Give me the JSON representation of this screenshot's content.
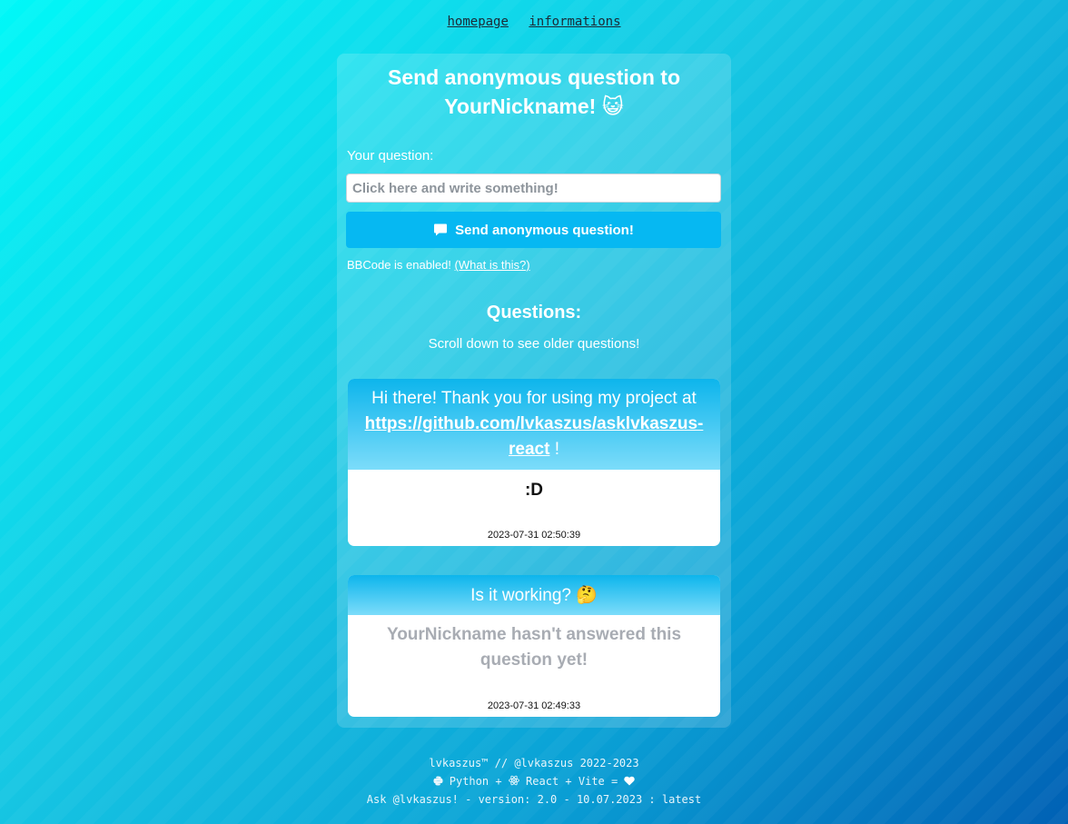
{
  "nav": {
    "links": [
      "homepage",
      "informations"
    ]
  },
  "form": {
    "title_line1": "Send anonymous question to",
    "title_line2": "YourNickname!",
    "title_emoji": "😺",
    "question_label": "Your question:",
    "input_placeholder": "Click here and write something!",
    "input_value": "",
    "send_button_label": "Send anonymous question!",
    "send_button_icon": "speech-bubble-icon",
    "bbcode_text": "BBCode is enabled!",
    "bbcode_link": "(What is this?)"
  },
  "questions": {
    "heading": "Questions:",
    "subtitle": "Scroll down to see older questions!",
    "items": [
      {
        "question_prefix": "Hi there! Thank you for using my project at",
        "question_link": "https://github.com/lvkaszus/asklvkaszus-react",
        "question_suffix": "!",
        "answer": ":D",
        "timestamp": "2023-07-31 02:50:39"
      },
      {
        "question": "Is it working?",
        "question_emoji": "🤔",
        "answer_pending": "YourNickname hasn't answered this question yet!",
        "timestamp": "2023-07-31 02:49:33"
      }
    ]
  },
  "footer": {
    "line1": "lvkaszus™ // @lvkaszus 2022-2023",
    "line2_parts": [
      "Python",
      "+",
      "React",
      "+",
      "Vite",
      "="
    ],
    "line2_icons": [
      "python-icon",
      "react-icon",
      "heart-icon"
    ],
    "line3": "Ask @lvkaszus! - version: 2.0 - 10.07.2023 : latest"
  },
  "colors": {
    "accent": "#06b8f2",
    "gradient_start": "#00f8f8",
    "gradient_end": "#0060b4"
  }
}
